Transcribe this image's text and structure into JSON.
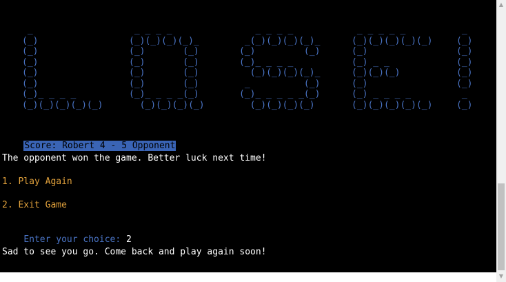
{
  "banner": {
    "letter_l": " _\n(_)\n(_)\n(_)\n(_)\n(_)\n(_)_ _ _ _\n(_)(_)(_)(_)(_)",
    "letter_o": " _ _ _ _\n(_)(_)(_)(_)_\n(_)       (_)\n(_)       (_)\n(_)       (_)\n(_)       (_)\n(_)_ _ _ _(_)\n  (_)(_)(_)(_)",
    "letter_s": "   _ _ _ _\n _(_)(_)(_)(_)_\n(_)         (_)\n(_)_ _ _ _\n  (_)(_)(_)(_)_\n _          (_)\n(_)_ _ _ _ _(_)\n  (_)(_)(_)(_)",
    "letter_e": " _ _ _ _ _\n(_)(_)(_)(_)(_)\n(_)\n(_) _ _\n(_)(_)(_)\n(_)\n(_) _ _ _ _\n(_)(_)(_)(_)(_)",
    "letter_bang": " _\n(_)\n(_)\n(_)\n(_)\n(_)\n _\n(_)"
  },
  "score": {
    "text": "Score: Robert 4 - 5 Opponent"
  },
  "result": {
    "text": "The opponent won the game. Better luck next time!"
  },
  "menu": {
    "play_again": "1. Play Again",
    "exit_game": "2. Exit Game"
  },
  "prompt": {
    "label": "Enter your choice: ",
    "value": "2"
  },
  "farewell": {
    "text": "Sad to see you go. Come back and play again soon!"
  },
  "scrollbar": {
    "up_arrow": "▲",
    "down_arrow": "▼"
  },
  "colors": {
    "background": "#000000",
    "text": "#ffffff",
    "banner_blue": "#4a74c5",
    "highlight": "#3a64b5",
    "menu_orange": "#e4a33c"
  }
}
